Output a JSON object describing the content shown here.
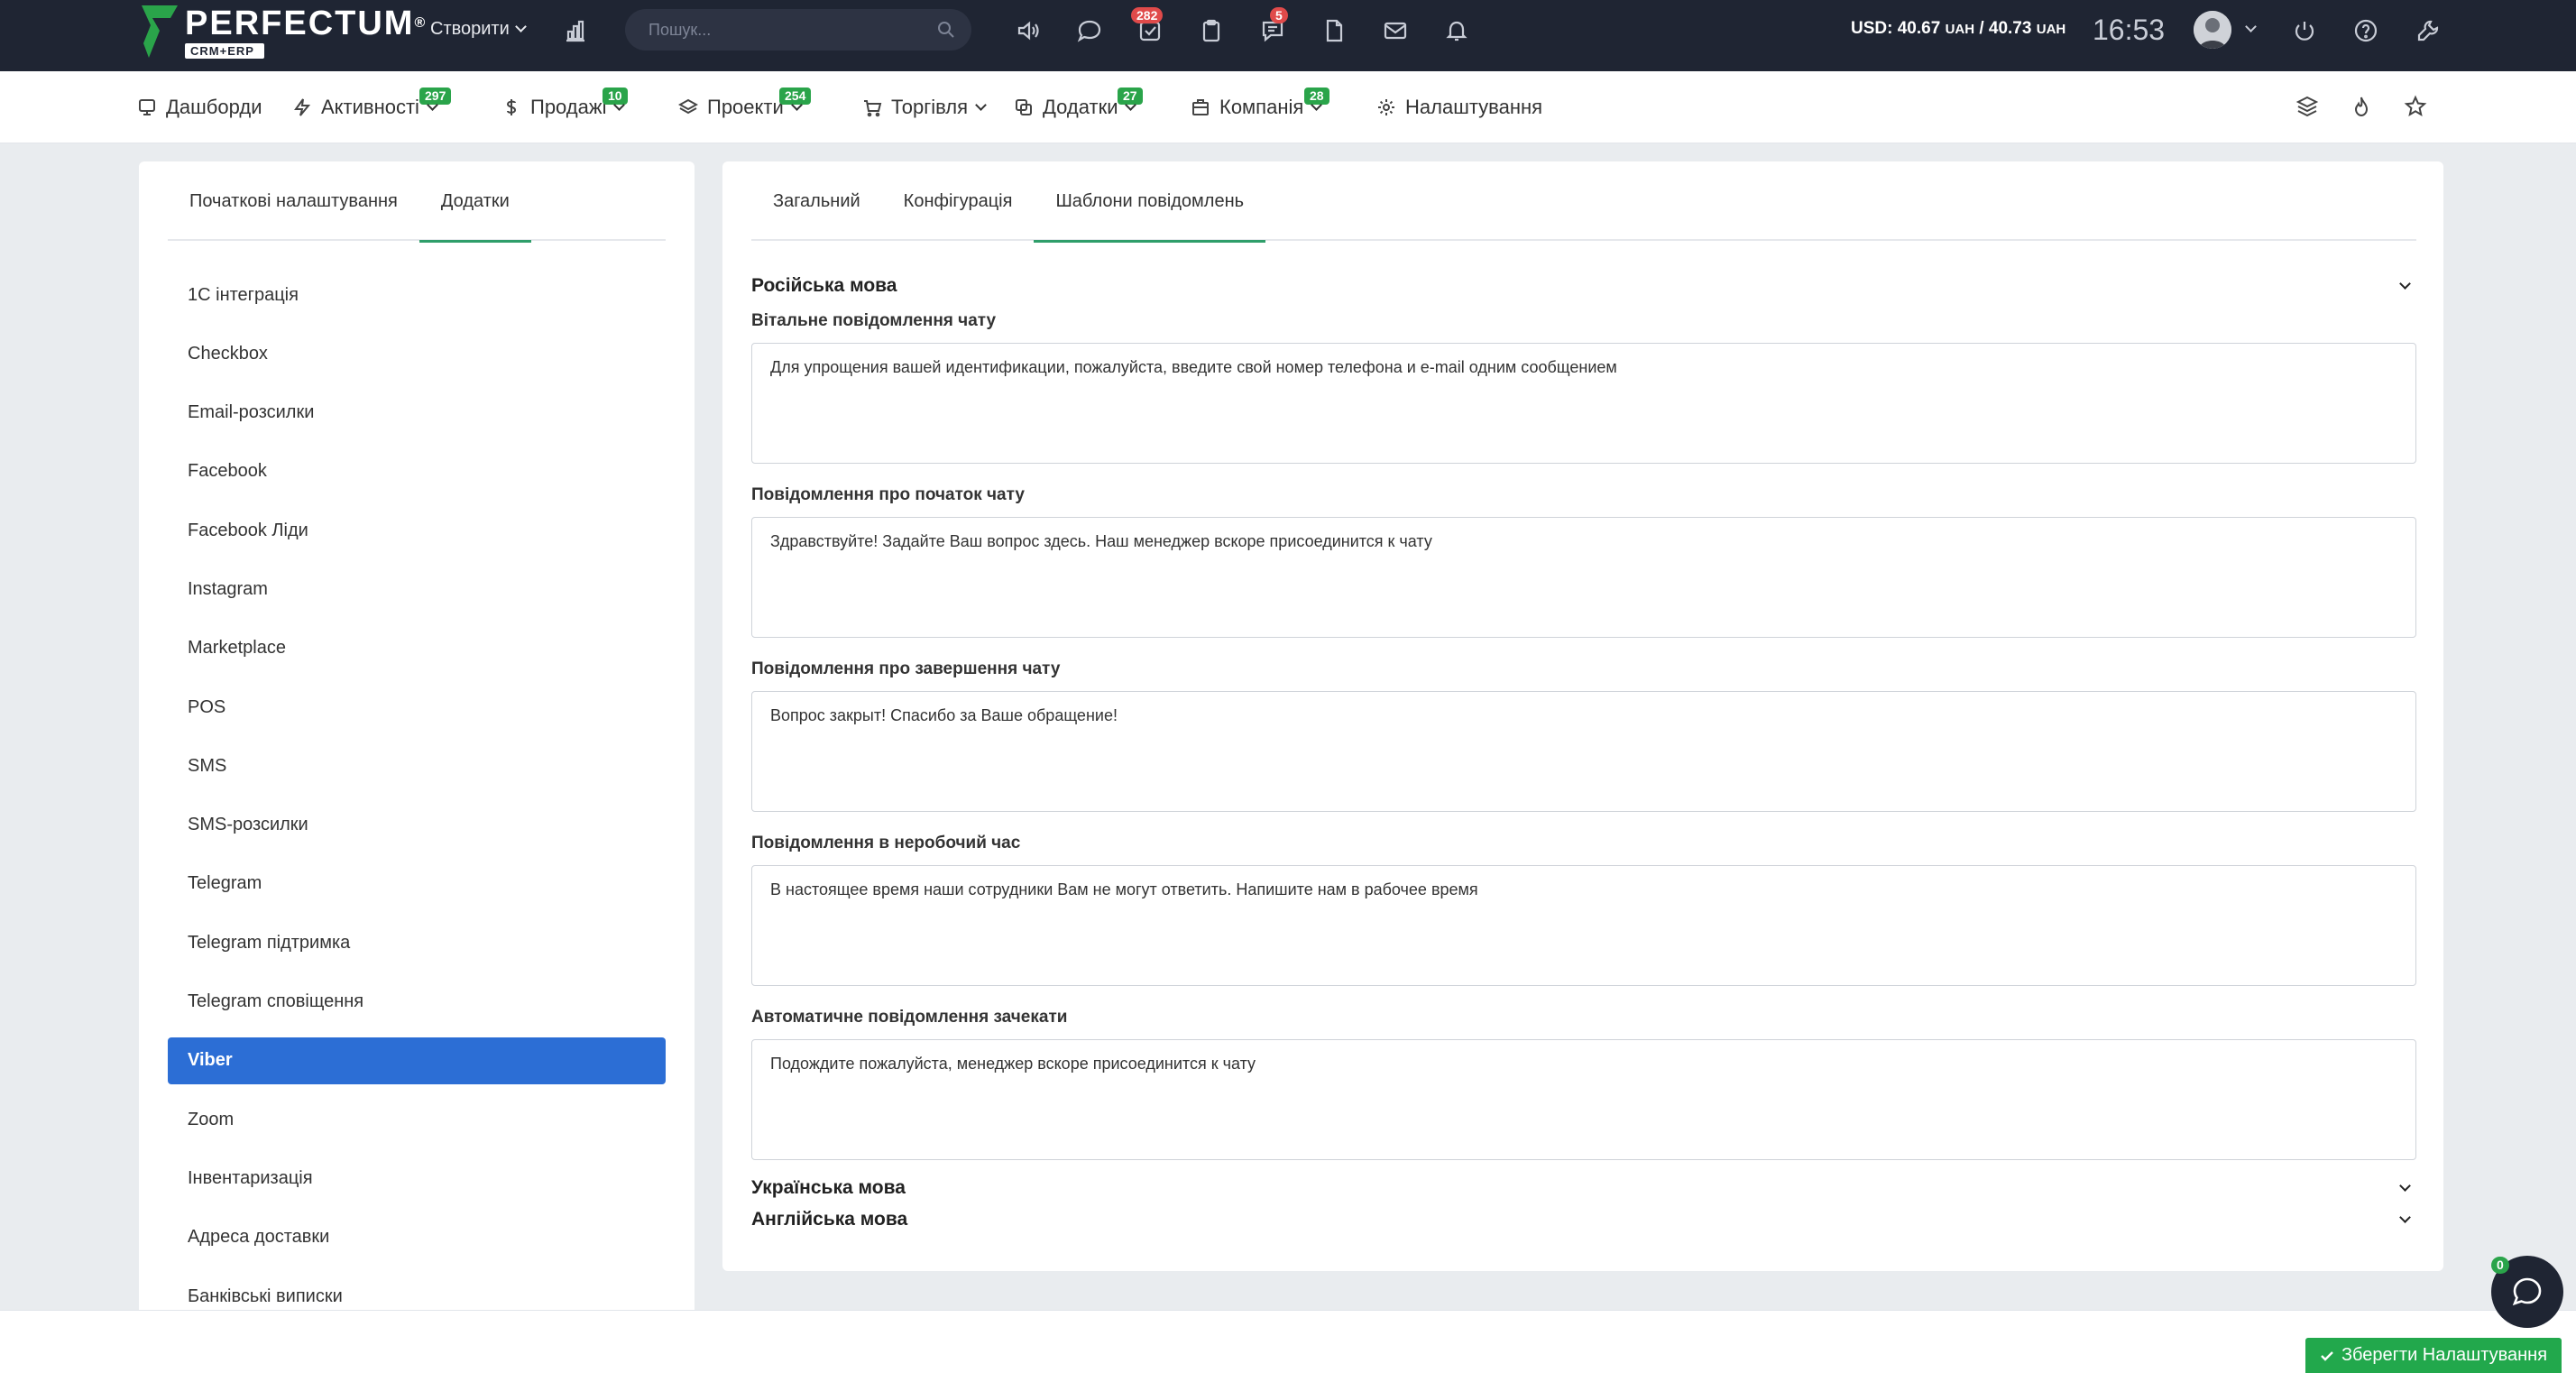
{
  "topbar": {
    "logo_text": "PERFECTUM",
    "logo_reg": "®",
    "logo_sub": "CRM+ERP",
    "create_label": "Створити",
    "search_placeholder": "Пошук...",
    "tasks_badge": "282",
    "messages_badge": "5",
    "currency_usd": "USD: 40.67",
    "currency_uah1": "UAH",
    "currency_sep": " / 40.73",
    "currency_uah2": "UAH",
    "clock": "16:53",
    "icons": [
      "analytics-icon",
      "search-icon",
      "megaphone-icon",
      "chat-bubble-icon",
      "tasks-icon",
      "clipboard-icon",
      "notes-icon",
      "document-icon",
      "mail-icon",
      "bell-icon",
      "power-icon",
      "help-icon",
      "wrench-icon"
    ]
  },
  "nav": {
    "items": [
      {
        "label": "Дашборди",
        "badge": ""
      },
      {
        "label": "Активності",
        "badge": "297"
      },
      {
        "label": "Продажі",
        "badge": "10"
      },
      {
        "label": "Проекти",
        "badge": "254"
      },
      {
        "label": "Торгівля",
        "badge": ""
      },
      {
        "label": "Додатки",
        "badge": "27"
      },
      {
        "label": "Компанія",
        "badge": "28"
      },
      {
        "label": "Налаштування",
        "badge": ""
      }
    ]
  },
  "left_panel": {
    "tabs": [
      "Початкові налаштування",
      "Додатки"
    ],
    "active_tab": "Додатки",
    "items": [
      "1С інтеграція",
      "Checkbox",
      "Email-розсилки",
      "Facebook",
      "Facebook Ліди",
      "Instagram",
      "Marketplace",
      "POS",
      "SMS",
      "SMS-розсилки",
      "Telegram",
      "Telegram підтримка",
      "Telegram сповіщення",
      "Viber",
      "Zoom",
      "Інвентаризація",
      "Адреса доставки",
      "Банківські виписки"
    ],
    "active_item": "Viber"
  },
  "right_panel": {
    "tabs": [
      "Загальний",
      "Конфігурація",
      "Шаблони повідомлень"
    ],
    "active_tab": "Шаблони повідомлень",
    "section_ru": "Російська мова",
    "fields": [
      {
        "label": "Вітальне повідомлення чату",
        "value": "Для упрощения вашей идентификации, пожалуйста, введите свой номер телефона и e-mail одним сообщением"
      },
      {
        "label": "Повідомлення про початок чату",
        "value": "Здравствуйте! Задайте Ваш вопрос здесь. Наш менеджер вскоре присоединится к чату"
      },
      {
        "label": "Повідомлення про завершення чату",
        "value": "Вопрос закрыт! Спасибо за Ваше обращение!"
      },
      {
        "label": "Повідомлення в неробочий час",
        "value": "В настоящее время наши сотрудники Вам не могут ответить. Напишите нам в рабочее время"
      },
      {
        "label": "Автоматичне повідомлення зачекати",
        "value": "Подождите пожалуйста, менеджер вскоре присоединится к чату"
      }
    ],
    "section_ua": "Українська мова",
    "section_en": "Англійська мова"
  },
  "chat_fab_badge": "0",
  "save_button": "Зберегти Налаштування",
  "colors": {
    "topbar": "#1f2533",
    "accent_blue": "#2c6ed5",
    "accent_green": "#22a84c",
    "badge_red": "#e04a4a"
  }
}
